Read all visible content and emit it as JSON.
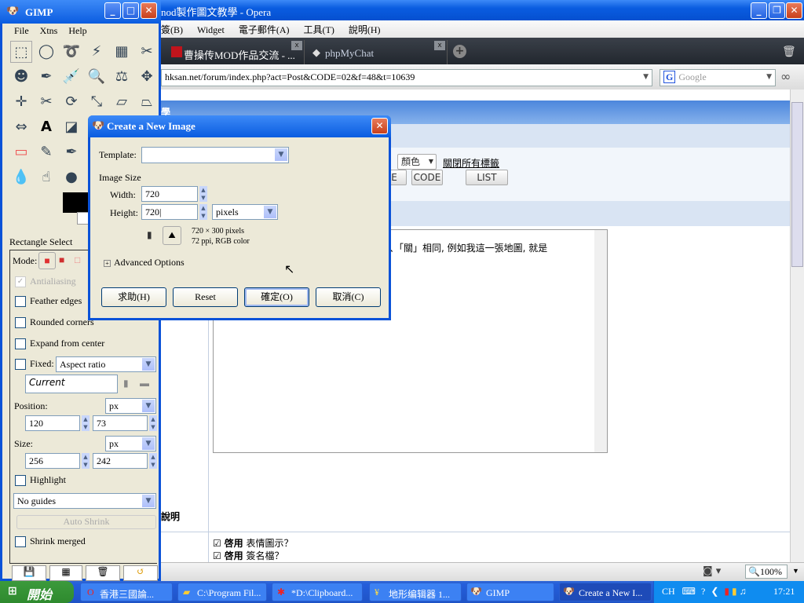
{
  "opera": {
    "title": "nod製作圖文教學 - Opera",
    "menu": [
      "簽(B)",
      "Widget",
      "電子郵件(A)",
      "工具(T)",
      "說明(H)"
    ],
    "tabs": [
      {
        "label": "曹操传MOD作品交流 - ..."
      },
      {
        "label": "phpMyChat"
      }
    ],
    "address": "hksan.net/forum/index.php?act=Post&CODE=02&f=48&t=10639",
    "search_placeholder": "Google",
    "zoom": "100%"
  },
  "forum": {
    "header": "學",
    "color_select": "顏色",
    "close_tags_link": "關閉所有標籤",
    "buttons": [
      "E",
      "CODE",
      "LIST"
    ],
    "post_text": "、「關」相同, 例如我這一張地圖, 就是",
    "side_label": "說明",
    "options": [
      {
        "bold": "啓用",
        "text": "表情圖示？",
        "checked": true
      },
      {
        "bold": "啓用",
        "text": "簽名檔？",
        "checked": true
      }
    ]
  },
  "gimp": {
    "title": "GIMP",
    "menu": [
      "File",
      "Xtns",
      "Help"
    ],
    "tool_options_title": "Rectangle Select",
    "mode_label": "Mode:",
    "antialiasing": "Antialiasing",
    "feather": "Feather edges",
    "rounded": "Rounded corners",
    "expand": "Expand from center",
    "fixed": "Fixed:",
    "fixed_select": "Aspect ratio",
    "current": "Current",
    "position_label": "Position:",
    "position_unit": "px",
    "position_x": "120",
    "position_y": "73",
    "size_label": "Size:",
    "size_unit": "px",
    "size_w": "256",
    "size_h": "242",
    "highlight": "Highlight",
    "guides": "No guides",
    "auto_shrink": "Auto Shrink",
    "shrink_merged": "Shrink merged"
  },
  "dialog": {
    "title": "Create a New Image",
    "template_label": "Template:",
    "template_value": "",
    "image_size": "Image Size",
    "width_label": "Width:",
    "width": "720",
    "height_label": "Height:",
    "height": "720",
    "unit": "pixels",
    "info1": "720 × 300 pixels",
    "info2": "72 ppi, RGB color",
    "advanced": "Advanced Options",
    "help": "求助(H)",
    "reset": "Reset",
    "ok": "確定(O)",
    "cancel": "取消(C)"
  },
  "taskbar": {
    "start": "開始",
    "items": [
      "香港三國論...",
      "C:\\Program Fil...",
      "*D:\\Clipboard...",
      "地形编辑器 1...",
      "GIMP",
      "Create a New I..."
    ],
    "lang": "CH",
    "clock": "17:21"
  }
}
